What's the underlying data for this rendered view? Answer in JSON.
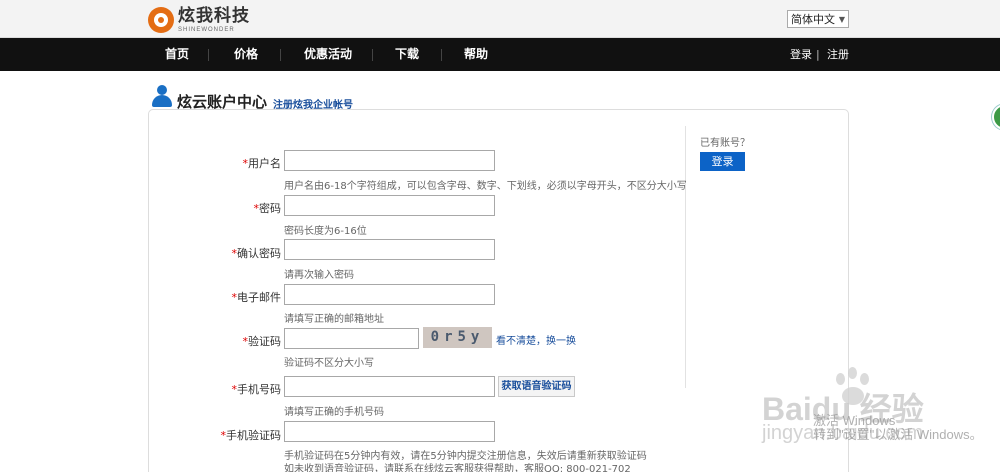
{
  "header": {
    "logo_cn": "炫我科技",
    "logo_en": "SHINEWONDER",
    "language": "简体中文"
  },
  "nav": {
    "items": [
      {
        "label": "首页"
      },
      {
        "label": "价格"
      },
      {
        "label": "优惠活动"
      },
      {
        "label": "下载"
      },
      {
        "label": "帮助"
      }
    ],
    "login": "登录",
    "divider": "|",
    "register": "注册"
  },
  "page": {
    "title": "炫云账户中心",
    "enterprise_link": "注册炫我企业帐号"
  },
  "form": {
    "required_mark": "*",
    "username": {
      "label": "用户名",
      "hint": "用户名由6-18个字符组成，可以包含字母、数字、下划线，必须以字母开头，不区分大小写"
    },
    "password": {
      "label": "密码",
      "hint": "密码长度为6-16位"
    },
    "confirm_password": {
      "label": "确认密码",
      "hint": "请再次输入密码"
    },
    "email": {
      "label": "电子邮件",
      "hint": "请填写正确的邮箱地址"
    },
    "captcha": {
      "label": "验证码",
      "hint": "验证码不区分大小写",
      "image_text": "0r5y",
      "refresh_link": "看不清楚，换一换"
    },
    "phone": {
      "label": "手机号码",
      "hint": "请填写正确的手机号码",
      "voice_button": "获取语音验证码"
    },
    "sms_code": {
      "label": "手机验证码",
      "hint_line1": "手机验证码在5分钟内有效，请在5分钟内提交注册信息，失效后请重新获取验证码",
      "hint_line2": "如未收到语音验证码，请联系在线炫云客服获得帮助，客服QQ: 800-021-702"
    }
  },
  "sidebar": {
    "has_account": "已有账号？",
    "login_button": "登录"
  },
  "watermarks": {
    "windows_line1": "激活 Windows",
    "windows_line2": "转到\"设置\"以激活 Windows。",
    "baidu": "Baidu 经验",
    "baidu_url": "jingyan.baidu.com"
  },
  "colors": {
    "nav_bg": "#111111",
    "link_blue": "#1a4f9c",
    "login_button_bg": "#0c63c7",
    "required_red": "#dd0000",
    "logo_orange": "#e46d14"
  }
}
